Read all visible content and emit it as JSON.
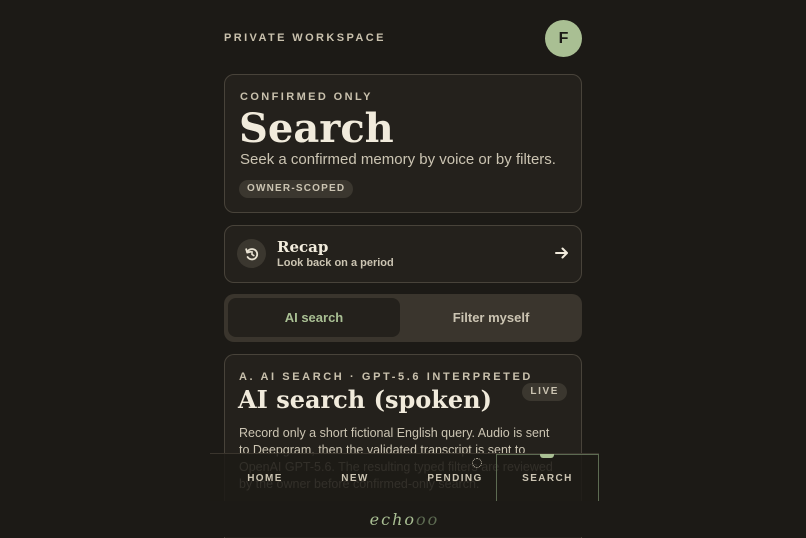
{
  "header": {
    "workspace_label": "PRIVATE WORKSPACE",
    "avatar_initial": "F"
  },
  "hero": {
    "kicker": "CONFIRMED ONLY",
    "title": "Search",
    "subtitle": "Seek a confirmed memory by voice or by filters.",
    "badge": "OWNER-SCOPED"
  },
  "recap": {
    "title": "Recap",
    "subtitle": "Look back on a period",
    "icon": "history-icon",
    "arrow": "arrow-right-icon"
  },
  "tabs": [
    {
      "label": "AI search",
      "active": true
    },
    {
      "label": "Filter myself",
      "active": false
    }
  ],
  "ai_card": {
    "kicker": "A. AI SEARCH · GPT-5.6 INTERPRETED",
    "title": "AI search (spoken)",
    "live_badge": "LIVE",
    "body": "Record only a short fictional English query. Audio is sent to Deepgram, then the validated transcript is sent to OpenAI GPT-5.6. The resulting typed filters are reviewed by the owner before confirmed-only search."
  },
  "nav": [
    {
      "label": "HOME"
    },
    {
      "label": "NEW"
    },
    {
      "label": "PENDING"
    },
    {
      "label": "SEARCH",
      "active": true
    }
  ],
  "footer": {
    "logo_strong": "echo",
    "logo_dim": "oo"
  },
  "colors": {
    "background": "#1c1a16",
    "card": "#24211c",
    "accent": "#a9bf93",
    "text": "#e9e3d3"
  }
}
